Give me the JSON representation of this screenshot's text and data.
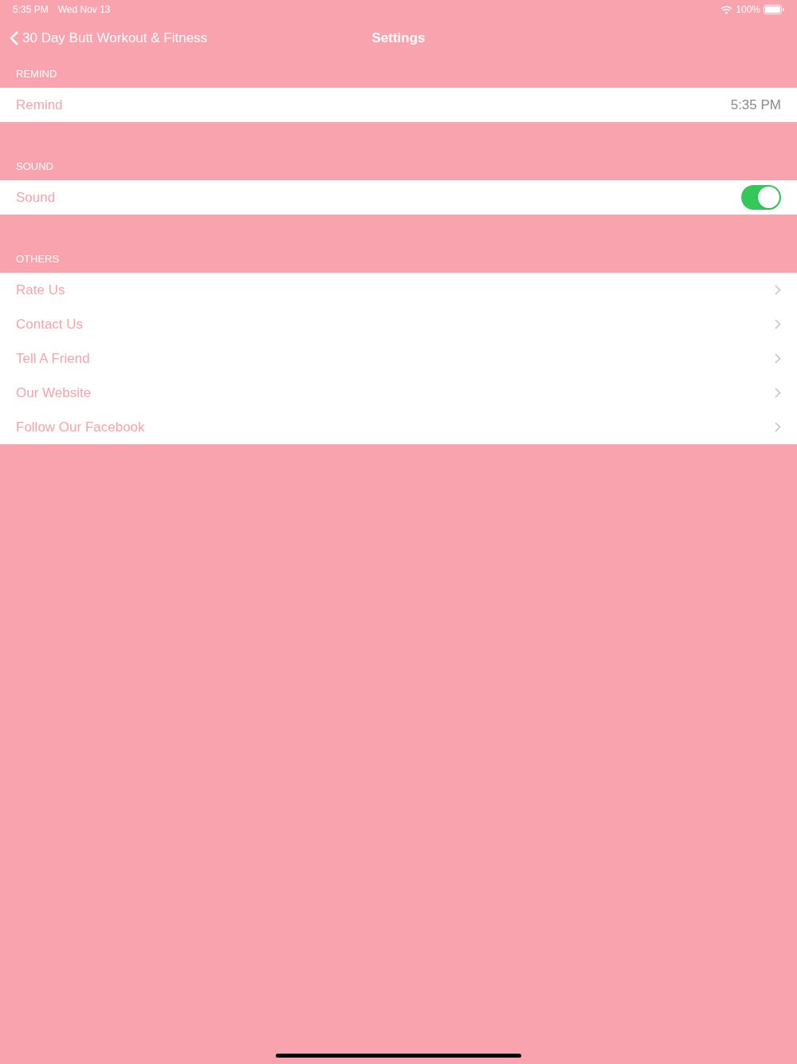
{
  "status_bar": {
    "time": "5:35 PM",
    "date": "Wed Nov 13",
    "battery": "100%"
  },
  "nav": {
    "back_label": "30 Day Butt Workout & Fitness",
    "title": "Settings"
  },
  "sections": [
    {
      "header": "REMIND",
      "rows": [
        {
          "kind": "value",
          "label": "Remind",
          "value": "5:35 PM"
        }
      ]
    },
    {
      "header": "SOUND",
      "rows": [
        {
          "kind": "toggle",
          "label": "Sound",
          "on": true
        }
      ]
    },
    {
      "header": "OTHERS",
      "rows": [
        {
          "kind": "link",
          "label": "Rate Us"
        },
        {
          "kind": "link",
          "label": "Contact Us"
        },
        {
          "kind": "link",
          "label": "Tell A Friend"
        },
        {
          "kind": "link",
          "label": "Our Website"
        },
        {
          "kind": "link",
          "label": "Follow Our Facebook"
        }
      ]
    }
  ]
}
